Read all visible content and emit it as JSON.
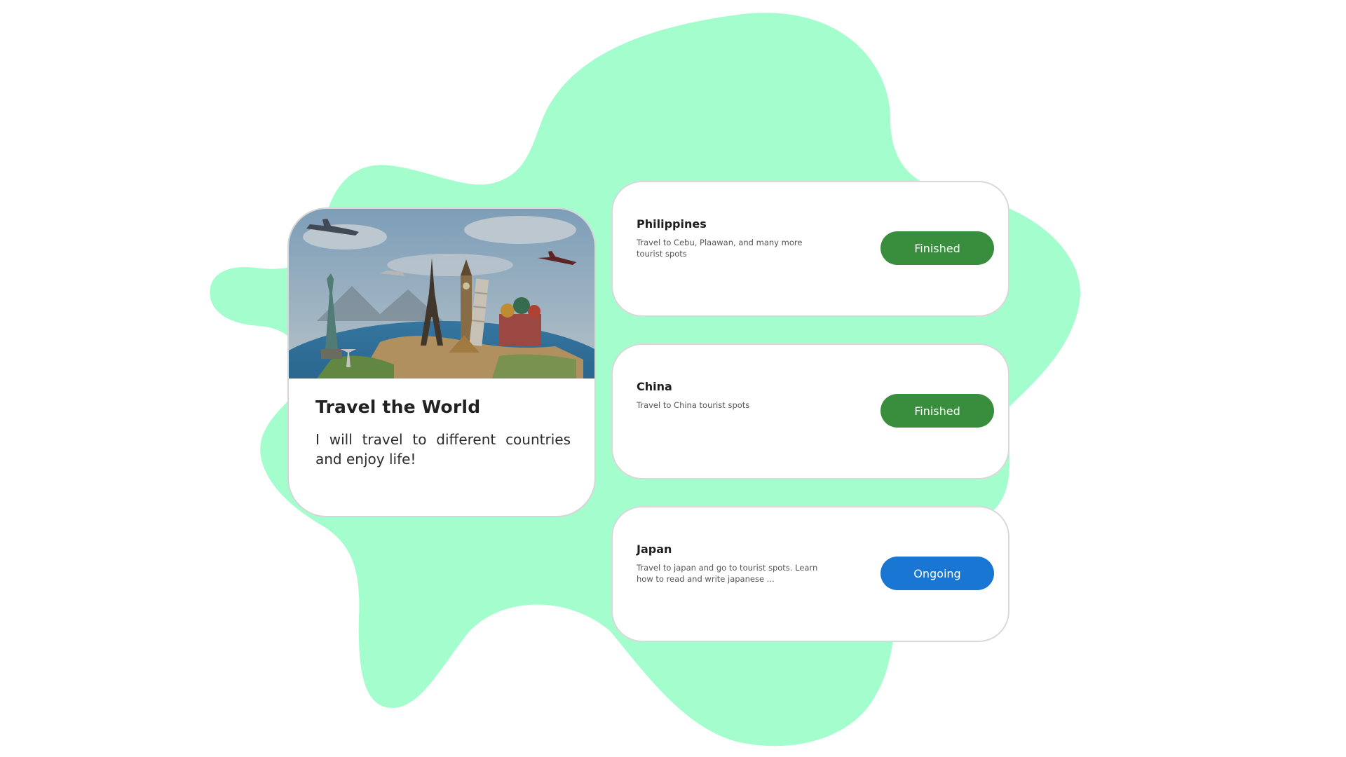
{
  "colors": {
    "blob": "#a3fdcd",
    "finished": "#388e3c",
    "ongoing": "#1976d2"
  },
  "goal": {
    "image_icon": "world-landmarks-illustration",
    "title": "Travel the World",
    "description": "I will travel to different countries and enjoy life!"
  },
  "tasks": [
    {
      "title": "Philippines",
      "description": "Travel to Cebu, Plaawan, and many more tourist spots",
      "status": "Finished"
    },
    {
      "title": "China",
      "description": "Travel to China tourist spots",
      "status": "Finished"
    },
    {
      "title": "Japan",
      "description": "Travel to japan and go to tourist spots. Learn how to read and write japanese ...",
      "status": "Ongoing"
    }
  ]
}
